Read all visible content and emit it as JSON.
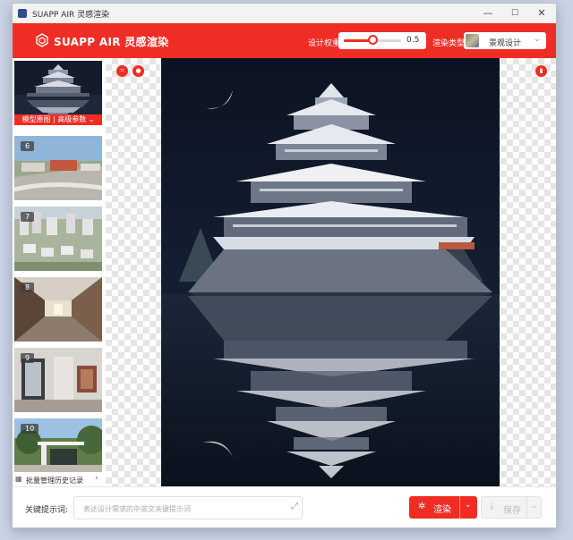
{
  "window": {
    "title": "SUAPP AIR 灵感渲染",
    "minimize": "—",
    "maximize": "☐",
    "close": "✕"
  },
  "header": {
    "brand": "SUAPP AIR 灵感渲染",
    "weight_label": "设计权重",
    "weight_value": "0.5",
    "weight_fraction": 0.5,
    "render_type_label": "渲染类型",
    "render_type_value": "景观设计",
    "accent_color": "#f02d24"
  },
  "sidebar": {
    "items": [
      {
        "number": "",
        "selected": true,
        "caption": "模型原图 | 高级参数 ⌄",
        "image": "castle-thumbnail"
      },
      {
        "number": "6",
        "selected": false,
        "caption": "",
        "image": "campus-aerial-thumbnail"
      },
      {
        "number": "7",
        "selected": false,
        "caption": "",
        "image": "residential-aerial-thumbnail"
      },
      {
        "number": "8",
        "selected": false,
        "caption": "",
        "image": "interior-corridor-thumbnail"
      },
      {
        "number": "9",
        "selected": false,
        "caption": "",
        "image": "office-glass-thumbnail"
      },
      {
        "number": "10",
        "selected": false,
        "caption": "",
        "image": "white-pavilion-thumbnail"
      }
    ],
    "history_label": "批量管理历史记录",
    "history_chevron": "›"
  },
  "canvas": {
    "crop_tool_icon": "crop-icon",
    "stamp_tool_icon": "stamp-icon",
    "delete_tool_icon": "trash-icon",
    "image": "castle-at-night-reflection"
  },
  "footer": {
    "keyword_label": "关键提示词:",
    "keyword_placeholder": "表达设计需求的中英文关键提示词",
    "keyword_value": "",
    "render_label": "渲染",
    "save_label": "保存"
  }
}
